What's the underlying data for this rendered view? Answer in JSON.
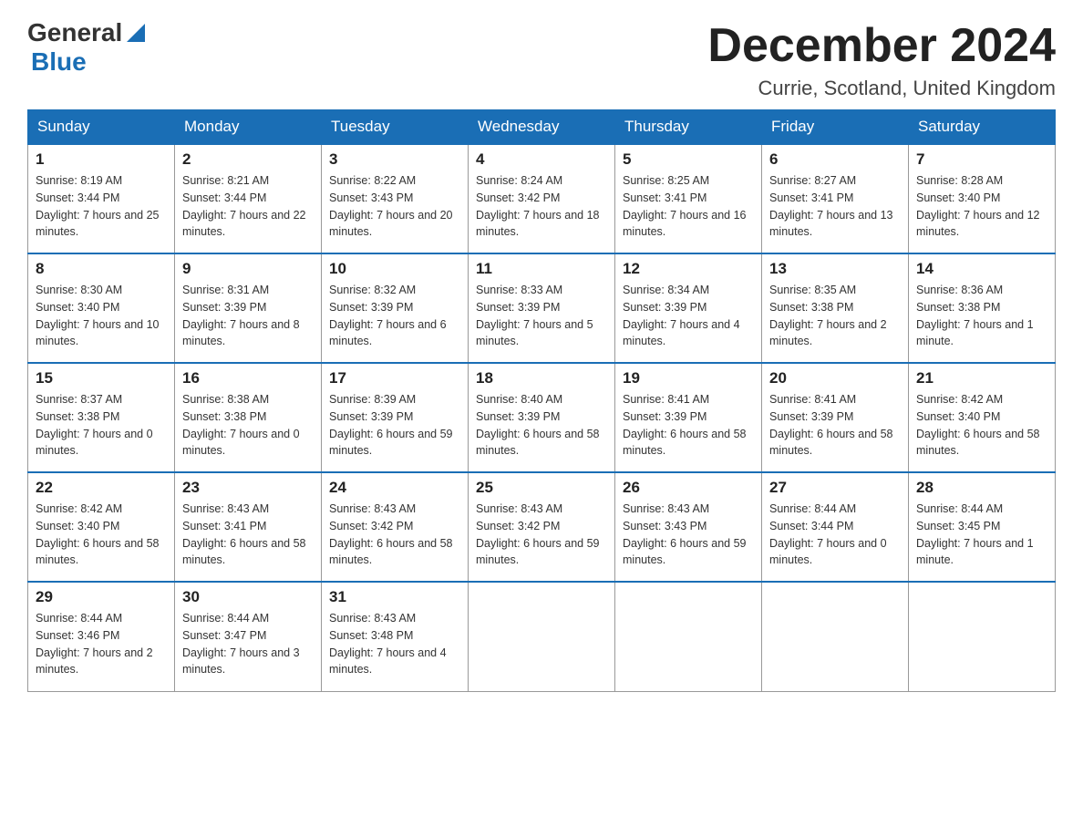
{
  "logo": {
    "general": "General",
    "blue": "Blue"
  },
  "title": "December 2024",
  "subtitle": "Currie, Scotland, United Kingdom",
  "days_of_week": [
    "Sunday",
    "Monday",
    "Tuesday",
    "Wednesday",
    "Thursday",
    "Friday",
    "Saturday"
  ],
  "weeks": [
    [
      {
        "day": "1",
        "sunrise": "8:19 AM",
        "sunset": "3:44 PM",
        "daylight": "7 hours and 25 minutes."
      },
      {
        "day": "2",
        "sunrise": "8:21 AM",
        "sunset": "3:44 PM",
        "daylight": "7 hours and 22 minutes."
      },
      {
        "day": "3",
        "sunrise": "8:22 AM",
        "sunset": "3:43 PM",
        "daylight": "7 hours and 20 minutes."
      },
      {
        "day": "4",
        "sunrise": "8:24 AM",
        "sunset": "3:42 PM",
        "daylight": "7 hours and 18 minutes."
      },
      {
        "day": "5",
        "sunrise": "8:25 AM",
        "sunset": "3:41 PM",
        "daylight": "7 hours and 16 minutes."
      },
      {
        "day": "6",
        "sunrise": "8:27 AM",
        "sunset": "3:41 PM",
        "daylight": "7 hours and 13 minutes."
      },
      {
        "day": "7",
        "sunrise": "8:28 AM",
        "sunset": "3:40 PM",
        "daylight": "7 hours and 12 minutes."
      }
    ],
    [
      {
        "day": "8",
        "sunrise": "8:30 AM",
        "sunset": "3:40 PM",
        "daylight": "7 hours and 10 minutes."
      },
      {
        "day": "9",
        "sunrise": "8:31 AM",
        "sunset": "3:39 PM",
        "daylight": "7 hours and 8 minutes."
      },
      {
        "day": "10",
        "sunrise": "8:32 AM",
        "sunset": "3:39 PM",
        "daylight": "7 hours and 6 minutes."
      },
      {
        "day": "11",
        "sunrise": "8:33 AM",
        "sunset": "3:39 PM",
        "daylight": "7 hours and 5 minutes."
      },
      {
        "day": "12",
        "sunrise": "8:34 AM",
        "sunset": "3:39 PM",
        "daylight": "7 hours and 4 minutes."
      },
      {
        "day": "13",
        "sunrise": "8:35 AM",
        "sunset": "3:38 PM",
        "daylight": "7 hours and 2 minutes."
      },
      {
        "day": "14",
        "sunrise": "8:36 AM",
        "sunset": "3:38 PM",
        "daylight": "7 hours and 1 minute."
      }
    ],
    [
      {
        "day": "15",
        "sunrise": "8:37 AM",
        "sunset": "3:38 PM",
        "daylight": "7 hours and 0 minutes."
      },
      {
        "day": "16",
        "sunrise": "8:38 AM",
        "sunset": "3:38 PM",
        "daylight": "7 hours and 0 minutes."
      },
      {
        "day": "17",
        "sunrise": "8:39 AM",
        "sunset": "3:39 PM",
        "daylight": "6 hours and 59 minutes."
      },
      {
        "day": "18",
        "sunrise": "8:40 AM",
        "sunset": "3:39 PM",
        "daylight": "6 hours and 58 minutes."
      },
      {
        "day": "19",
        "sunrise": "8:41 AM",
        "sunset": "3:39 PM",
        "daylight": "6 hours and 58 minutes."
      },
      {
        "day": "20",
        "sunrise": "8:41 AM",
        "sunset": "3:39 PM",
        "daylight": "6 hours and 58 minutes."
      },
      {
        "day": "21",
        "sunrise": "8:42 AM",
        "sunset": "3:40 PM",
        "daylight": "6 hours and 58 minutes."
      }
    ],
    [
      {
        "day": "22",
        "sunrise": "8:42 AM",
        "sunset": "3:40 PM",
        "daylight": "6 hours and 58 minutes."
      },
      {
        "day": "23",
        "sunrise": "8:43 AM",
        "sunset": "3:41 PM",
        "daylight": "6 hours and 58 minutes."
      },
      {
        "day": "24",
        "sunrise": "8:43 AM",
        "sunset": "3:42 PM",
        "daylight": "6 hours and 58 minutes."
      },
      {
        "day": "25",
        "sunrise": "8:43 AM",
        "sunset": "3:42 PM",
        "daylight": "6 hours and 59 minutes."
      },
      {
        "day": "26",
        "sunrise": "8:43 AM",
        "sunset": "3:43 PM",
        "daylight": "6 hours and 59 minutes."
      },
      {
        "day": "27",
        "sunrise": "8:44 AM",
        "sunset": "3:44 PM",
        "daylight": "7 hours and 0 minutes."
      },
      {
        "day": "28",
        "sunrise": "8:44 AM",
        "sunset": "3:45 PM",
        "daylight": "7 hours and 1 minute."
      }
    ],
    [
      {
        "day": "29",
        "sunrise": "8:44 AM",
        "sunset": "3:46 PM",
        "daylight": "7 hours and 2 minutes."
      },
      {
        "day": "30",
        "sunrise": "8:44 AM",
        "sunset": "3:47 PM",
        "daylight": "7 hours and 3 minutes."
      },
      {
        "day": "31",
        "sunrise": "8:43 AM",
        "sunset": "3:48 PM",
        "daylight": "7 hours and 4 minutes."
      },
      null,
      null,
      null,
      null
    ]
  ],
  "labels": {
    "sunrise": "Sunrise:",
    "sunset": "Sunset:",
    "daylight": "Daylight:"
  }
}
